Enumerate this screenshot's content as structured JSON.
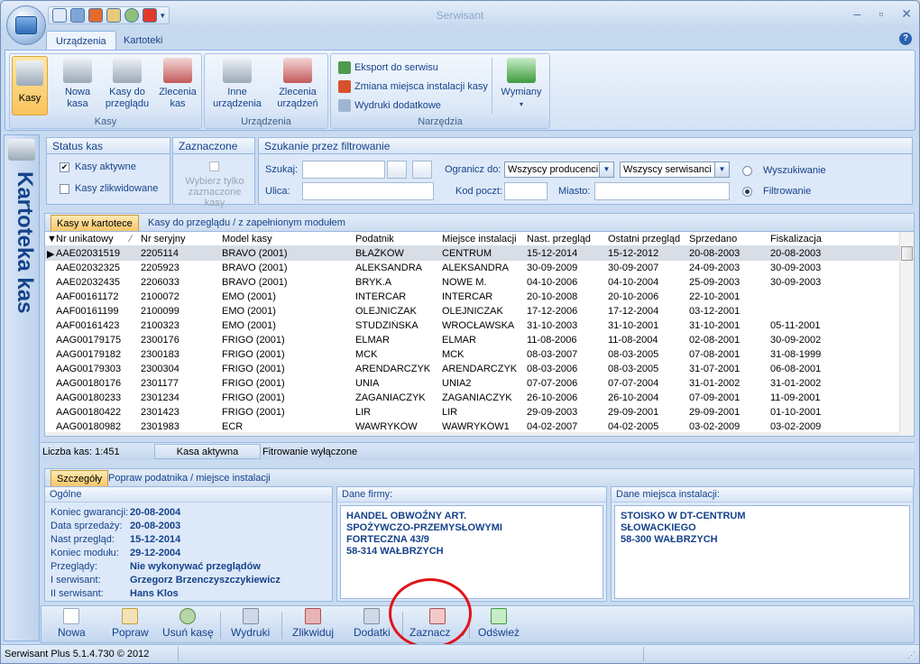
{
  "window": {
    "title": "Serwisant",
    "controls": [
      "–",
      "▫",
      "✕"
    ]
  },
  "ribbon_tabs": [
    "Urządzenia",
    "Kartoteki"
  ],
  "help_label": "?",
  "ribbon": {
    "groups": {
      "kasy": "Kasy",
      "urzadzenia": "Urządzenia",
      "narzedzia": "Narzędzia"
    },
    "kasy": {
      "kasy": "Kasy",
      "nowa": "Nowa\nkasa",
      "przeglad": "Kasy do\nprzeglądu",
      "zlecenia": "Zlecenia\nkas"
    },
    "urzadzenia": {
      "inne": "Inne\nurządzenia",
      "zlecenia": "Zlecenia\nurządzeń"
    },
    "narzedzia": {
      "eksport": "Eksport do serwisu",
      "zmiana": "Zmiana miejsca instalacji kasy",
      "wydruki": "Wydruki dodatkowe",
      "wymiany": "Wymiany"
    }
  },
  "side_title": "Kartoteka kas",
  "status_kas": {
    "title": "Status kas",
    "aktywne": "Kasy aktywne",
    "zlikwidowane": "Kasy zlikwidowane"
  },
  "zaznaczone": {
    "title": "Zaznaczone",
    "label": "Wybierz tylko zaznaczone kasy"
  },
  "search": {
    "title": "Szukanie przez filtrowanie",
    "szukaj": "Szukaj:",
    "ulica": "Ulica:",
    "ogranicz": "Ogranicz do:",
    "producenci": "Wszyscy producenci",
    "serwisanci": "Wszyscy serwisanci",
    "kod": "Kod poczt:",
    "miasto": "Miasto:",
    "wyszukiwanie": "Wyszukiwanie",
    "filtrowanie": "Filtrowanie"
  },
  "grid_tabs": [
    "Kasy w kartotece",
    "Kasy do przeglądu / z zapełnionym modułem"
  ],
  "columns": [
    "Nr unikatowy",
    "Nr seryjny",
    "Model kasy",
    "Podatnik",
    "Miejsce instalacji",
    "Nast. przegląd",
    "Ostatni przegląd",
    "Sprzedano",
    "Fiskalizacja"
  ],
  "rows": [
    [
      "AAE02031519",
      "2205114",
      "BRAVO (2001)",
      "BŁAŻKÓW",
      "CENTRUM",
      "15-12-2014",
      "15-12-2012",
      "20-08-2003",
      "20-08-2003"
    ],
    [
      "AAE02032325",
      "2205923",
      "BRAVO (2001)",
      "ALEKSANDRA",
      "ALEKSANDRA",
      "30-09-2009",
      "30-09-2007",
      "24-09-2003",
      "30-09-2003"
    ],
    [
      "AAE02032435",
      "2206033",
      "BRAVO (2001)",
      "BRYK.A",
      "NOWE M.",
      "04-10-2006",
      "04-10-2004",
      "25-09-2003",
      "30-09-2003"
    ],
    [
      "AAF00161172",
      "2100072",
      "EMO (2001)",
      "INTERCAR",
      "INTERCAR",
      "20-10-2008",
      "20-10-2006",
      "22-10-2001",
      ""
    ],
    [
      "AAF00161199",
      "2100099",
      "EMO (2001)",
      "OLEJNICZAK",
      "OLEJNICZAK",
      "17-12-2006",
      "17-12-2004",
      "03-12-2001",
      ""
    ],
    [
      "AAF00161423",
      "2100323",
      "EMO (2001)",
      "STUDZIŃSKA",
      "WROCŁAWSKA",
      "31-10-2003",
      "31-10-2001",
      "31-10-2001",
      "05-11-2001"
    ],
    [
      "AAG00179175",
      "2300176",
      "FRIGO (2001)",
      "ELMAR",
      "ELMAR",
      "11-08-2006",
      "11-08-2004",
      "02-08-2001",
      "30-09-2002"
    ],
    [
      "AAG00179182",
      "2300183",
      "FRIGO (2001)",
      "MCK",
      "MCK",
      "08-03-2007",
      "08-03-2005",
      "07-08-2001",
      "31-08-1999"
    ],
    [
      "AAG00179303",
      "2300304",
      "FRIGO (2001)",
      "ARENDARCZYK",
      "ARENDARCZYK",
      "08-03-2006",
      "08-03-2005",
      "31-07-2001",
      "06-08-2001"
    ],
    [
      "AAG00180176",
      "2301177",
      "FRIGO (2001)",
      "UNIA",
      "UNIA2",
      "07-07-2006",
      "07-07-2004",
      "31-01-2002",
      "31-01-2002"
    ],
    [
      "AAG00180233",
      "2301234",
      "FRIGO (2001)",
      "ZAGANIACZYK",
      "ZAGANIACZYK",
      "26-10-2006",
      "26-10-2004",
      "07-09-2001",
      "11-09-2001"
    ],
    [
      "AAG00180422",
      "2301423",
      "FRIGO (2001)",
      "LIR",
      "LIR",
      "29-09-2003",
      "29-09-2001",
      "29-09-2001",
      "01-10-2001"
    ],
    [
      "AAG00180982",
      "2301983",
      "ECR",
      "WAWRYKÓW",
      "WAWRYKÓW1",
      "04-02-2007",
      "04-02-2005",
      "03-02-2009",
      "03-02-2009"
    ]
  ],
  "grid_status": {
    "count": "Liczba kas:   1:451",
    "active": "Kasa aktywna",
    "filter": "Fitrowanie wyłączone"
  },
  "detail_tabs": [
    "Szczegóły",
    "Popraw podatnika / miejsce instalacji"
  ],
  "ogolne": {
    "title": "Ogólne",
    "items": [
      [
        "Koniec gwarancji:",
        "20-08-2004"
      ],
      [
        "Data sprzedaży:",
        "20-08-2003"
      ],
      [
        "Nast przegląd:",
        "15-12-2014"
      ],
      [
        "Koniec modułu:",
        "29-12-2004"
      ],
      [
        "Przeglądy:",
        "Nie wykonywać przeglądów"
      ],
      [
        "I serwisant:",
        "Grzegorz Brzenczyszczykiewicz"
      ],
      [
        "II serwisant:",
        "Hans Klos"
      ]
    ]
  },
  "firma": {
    "title": "Dane firmy:",
    "lines": [
      "HANDEL OBWOŹNY ART.",
      "SPOŻYWCZO-PRZEMYSŁOWYMI",
      "FORTECZNA 43/9",
      "58-314 WAŁBRZYCH"
    ]
  },
  "miejsce": {
    "title": "Dane miejsca instalacji:",
    "lines": [
      "STOISKO W DT-CENTRUM",
      "SŁOWACKIEGO",
      "58-300 WAŁBRZYCH"
    ]
  },
  "toolbar": {
    "nowa": "Nowa",
    "popraw": "Popraw",
    "usun": "Usuń kasę",
    "wydruki": "Wydruki",
    "zlikwiduj": "Zlikwiduj",
    "dodatki": "Dodatki",
    "zaznacz": "Zaznacz",
    "odswiez": "Odśwież"
  },
  "statusbar": "Serwisant Plus 5.1.4.730 © 2012",
  "colors": {
    "accent": "#15428b",
    "highlight": "#e0141b",
    "ribbon": "#dce8f7"
  }
}
